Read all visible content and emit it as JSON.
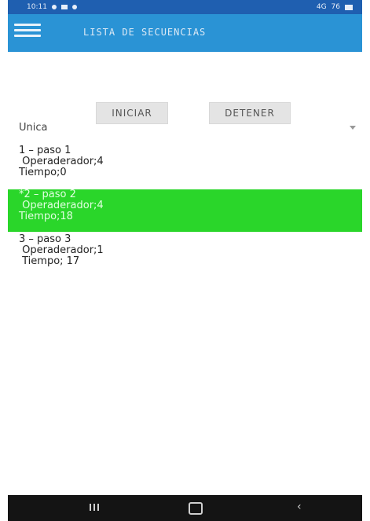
{
  "status_bar": {
    "time": "10:11",
    "signal": "4G",
    "battery": "76"
  },
  "app_bar": {
    "title": "LISTA DE SECUENCIAS"
  },
  "controls": {
    "start_label": "INICIAR",
    "stop_label": "DETENER"
  },
  "dropdown": {
    "selected": "Unica"
  },
  "items": [
    {
      "title": "1 – paso 1",
      "operator": " Operaderador;4",
      "time": "Tiempo;0",
      "active": false
    },
    {
      "title": "*2 – paso 2",
      "operator": " Operaderador;4",
      "time": "Tiempo;18",
      "active": true
    },
    {
      "title": "3 – paso 3",
      "operator": " Operaderador;1",
      "time": " Tiempo; 17",
      "active": false
    }
  ],
  "colors": {
    "app_bar": "#2a93d5",
    "status_bar": "#1f5fb0",
    "active_row": "#2ad62a",
    "nav_bar": "#141414"
  }
}
